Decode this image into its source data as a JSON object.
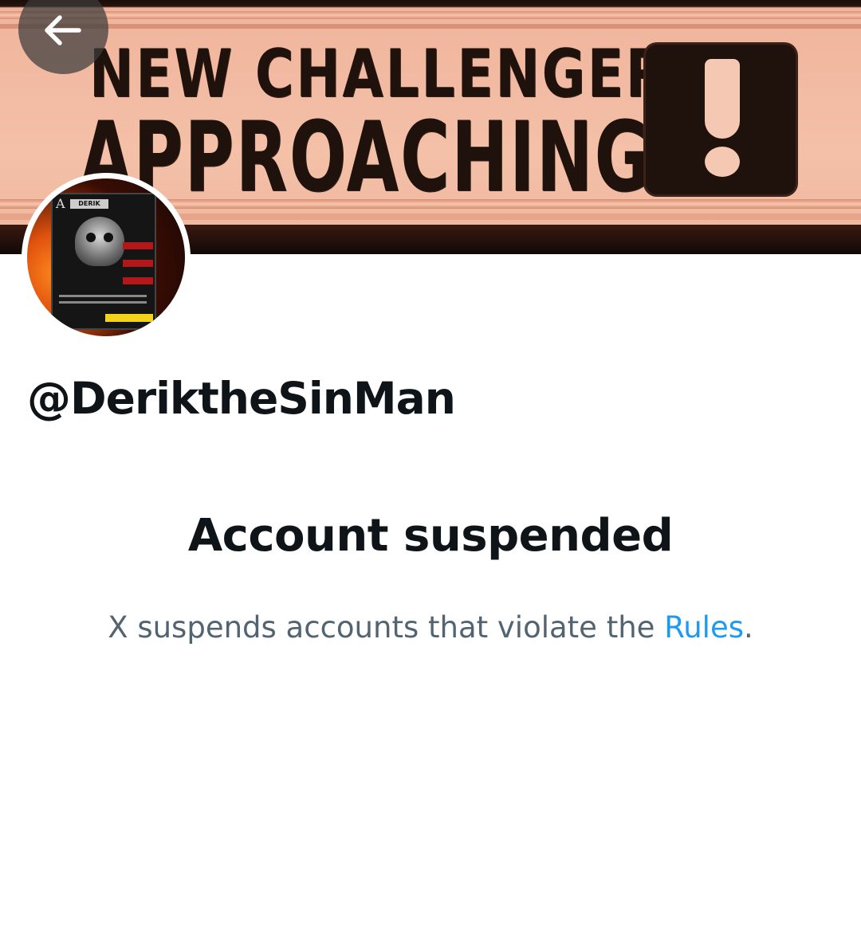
{
  "banner": {
    "line1": "NEW CHALLENGER",
    "line2": "APPROACHING",
    "symbol": "!"
  },
  "nav": {
    "back_icon": "arrow-left-icon"
  },
  "avatar": {
    "card_letter": "A",
    "card_name": "DERIK"
  },
  "profile": {
    "handle": "@DeriktheSinMan"
  },
  "suspension": {
    "title": "Account suspended",
    "message_prefix": "X suspends accounts that violate the ",
    "rules_link": "Rules",
    "message_suffix": "."
  },
  "colors": {
    "text_primary": "#0f1419",
    "text_secondary": "#536471",
    "link": "#1d9bf0"
  }
}
